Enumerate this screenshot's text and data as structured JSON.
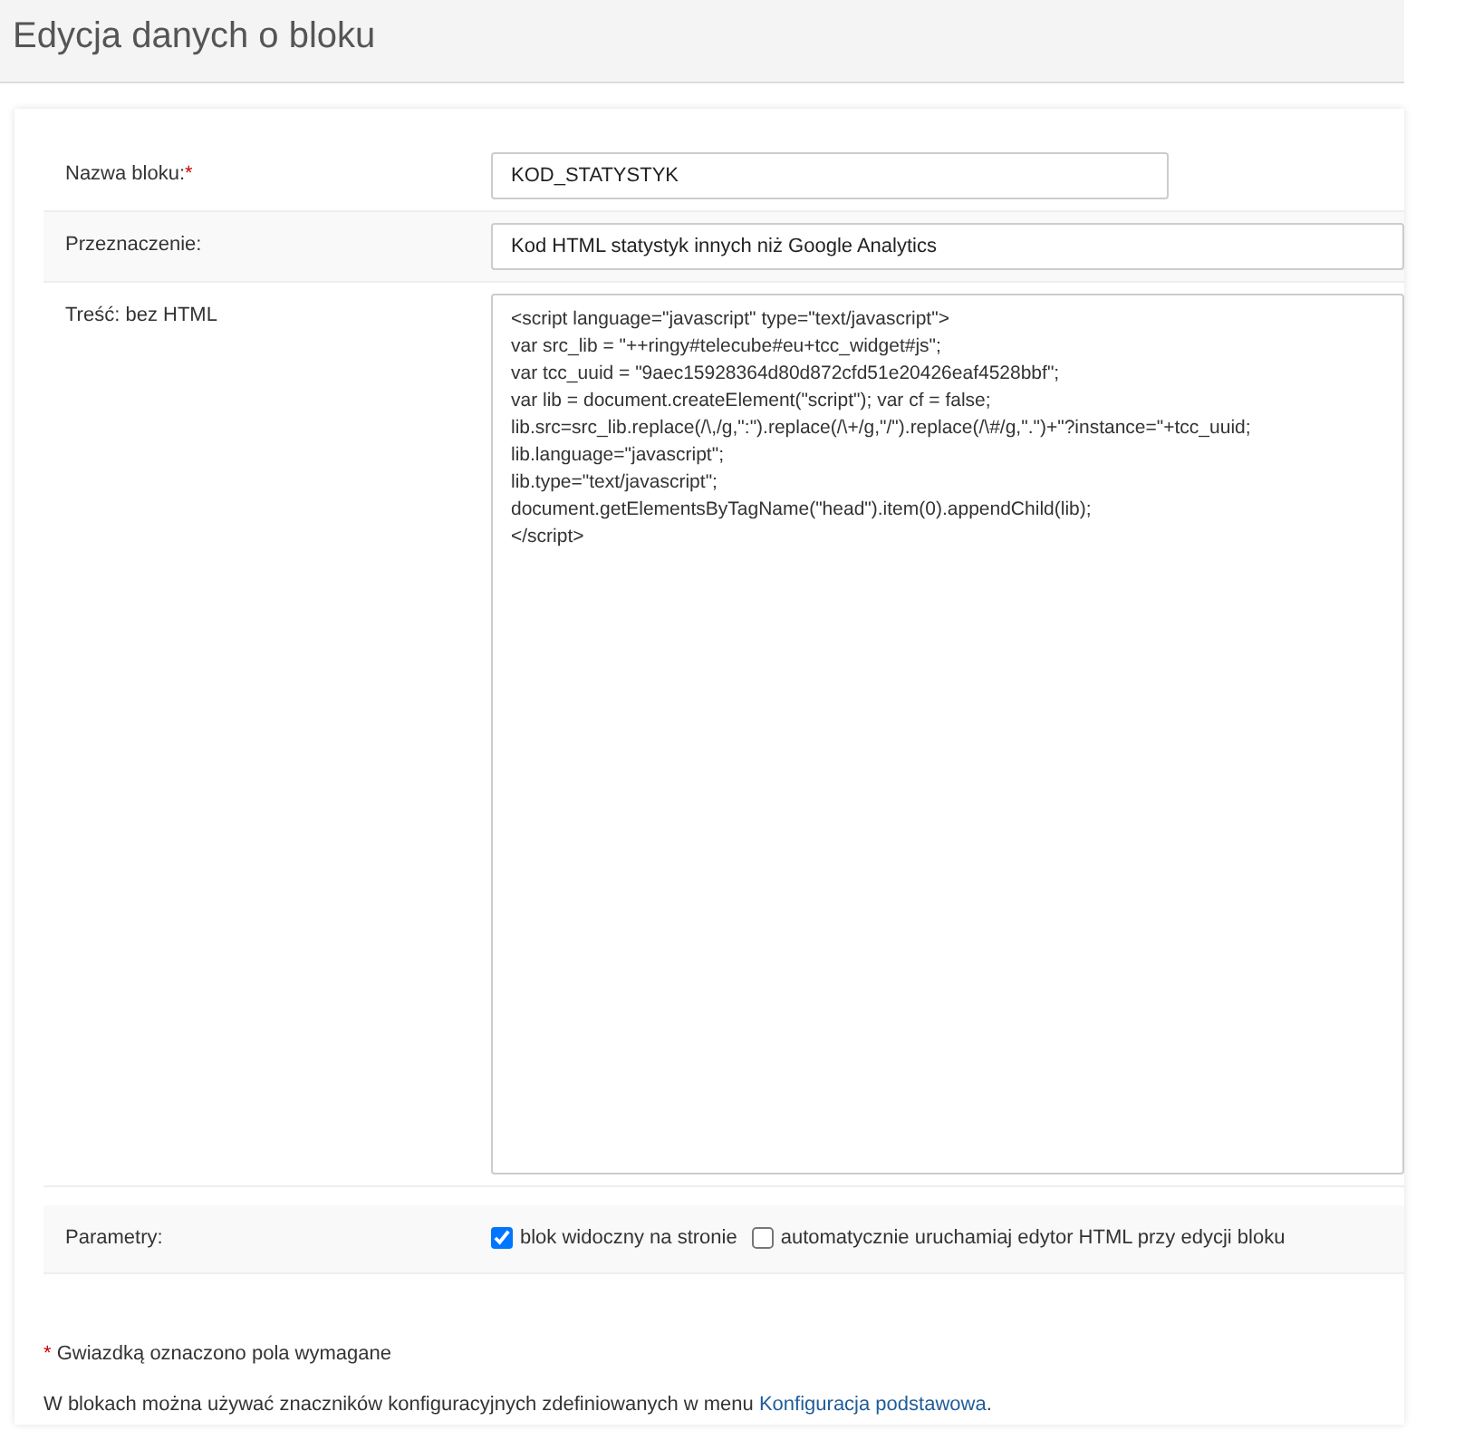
{
  "page_title": "Edycja danych o bloku",
  "fields": [
    {
      "kind": "input",
      "label": "Nazwa bloku:",
      "required_mark": "*",
      "value": "KOD_STATYSTYK",
      "wide": false
    },
    {
      "kind": "input",
      "label": "Przeznaczenie:",
      "value": "Kod HTML statystyk innych niż Google Analytics",
      "wide": true
    },
    {
      "kind": "textarea",
      "label": "Treść: bez HTML",
      "value": "<script language=\"javascript\" type=\"text/javascript\">\nvar src_lib = \"++ringy#telecube#eu+tcc_widget#js\";\nvar tcc_uuid = \"9aec15928364d80d872cfd51e20426eaf4528bbf\";\nvar lib = document.createElement(\"script\"); var cf = false;\nlib.src=src_lib.replace(/\\,/g,\":\").replace(/\\+/g,\"/\").replace(/\\#/g,\".\")+\"?instance=\"+tcc_uuid;\nlib.language=\"javascript\";\nlib.type=\"text/javascript\";\ndocument.getElementsByTagName(\"head\").item(0).appendChild(lib);\n</script>"
    },
    {
      "kind": "checkboxes",
      "label": "Parametry:",
      "options": [
        {
          "label": "blok widoczny na stronie",
          "checked": true
        },
        {
          "label": "automatycznie uruchamiaj edytor HTML przy edycji bloku",
          "checked": false
        }
      ]
    }
  ],
  "required_note": {
    "mark": "*",
    "text": "Gwiazdką oznaczono pola wymagane"
  },
  "info_note": {
    "text": "W blokach można używać znaczników konfiguracyjnych zdefiniowanych w menu",
    "link": "Konfiguracja podstawowa",
    "after": "."
  }
}
